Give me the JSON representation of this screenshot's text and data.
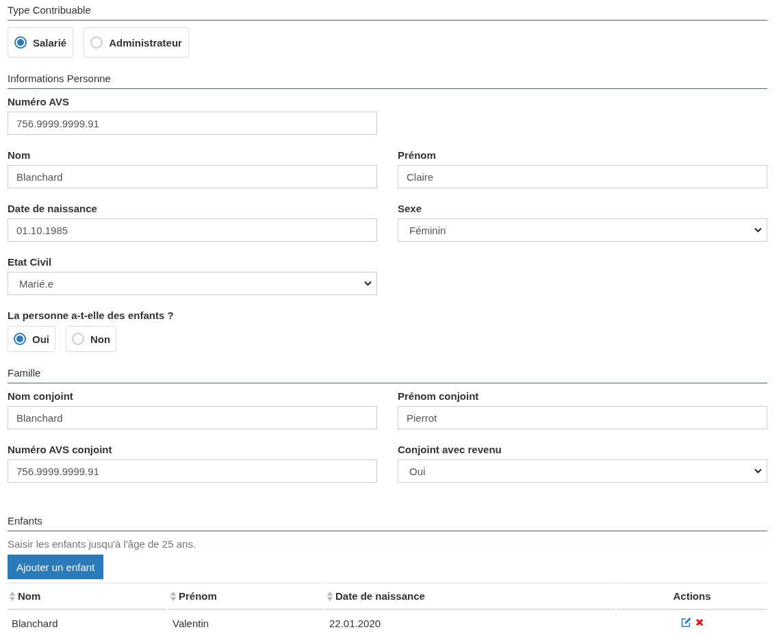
{
  "sections": [
    {
      "title": "Type Contribuable",
      "blocks": [
        {
          "kind": "radios",
          "options": [
            {
              "label": "Salarié",
              "selected": true
            },
            {
              "label": "Administrateur",
              "selected": false
            }
          ]
        }
      ]
    },
    {
      "title": "Informations Personne",
      "blocks": [
        {
          "kind": "fields",
          "rows": [
            [
              {
                "kind": "text",
                "label": "Numéro AVS",
                "value": "756.9999.9999.91"
              }
            ],
            [
              {
                "kind": "text",
                "label": "Nom",
                "value": "Blanchard"
              },
              {
                "kind": "text",
                "label": "Prénom",
                "value": "Claire"
              }
            ],
            [
              {
                "kind": "text",
                "label": "Date de naissance",
                "value": "01.10.1985"
              },
              {
                "kind": "select",
                "label": "Sexe",
                "value": "Féminin"
              }
            ],
            [
              {
                "kind": "select",
                "label": "Etat Civil",
                "value": "Marié.e"
              }
            ]
          ]
        },
        {
          "kind": "radios",
          "label": "La personne a-t-elle des enfants ?",
          "options": [
            {
              "label": "Oui",
              "selected": true
            },
            {
              "label": "Non",
              "selected": false
            }
          ]
        }
      ]
    },
    {
      "title": "Famille",
      "blocks": [
        {
          "kind": "fields",
          "rows": [
            [
              {
                "kind": "text",
                "label": "Nom conjoint",
                "value": "Blanchard"
              },
              {
                "kind": "text",
                "label": "Prénom conjoint",
                "value": "Pierrot"
              }
            ],
            [
              {
                "kind": "text",
                "label": "Numéro AVS conjoint",
                "value": "756.9999.9999.91"
              },
              {
                "kind": "select",
                "label": "Conjoint avec revenu",
                "value": "Oui"
              }
            ]
          ]
        }
      ]
    },
    {
      "title": "Enfants",
      "blocks": [
        {
          "kind": "note",
          "text": "Saisir les enfants jusqu'à l'âge de 25 ans."
        },
        {
          "kind": "button",
          "label": "Ajouter un enfant"
        },
        {
          "kind": "table",
          "columns": [
            {
              "label": "Nom",
              "sortable": true
            },
            {
              "label": "Prénom",
              "sortable": true
            },
            {
              "label": "Date de naissance",
              "sortable": true
            },
            {
              "label": "Actions",
              "sortable": false
            }
          ],
          "rows": [
            {
              "cells": [
                "Blanchard",
                "Valentin",
                "22.01.2020"
              ],
              "actions": [
                {
                  "kind": "edit"
                },
                {
                  "kind": "delete"
                }
              ]
            }
          ]
        }
      ]
    }
  ]
}
